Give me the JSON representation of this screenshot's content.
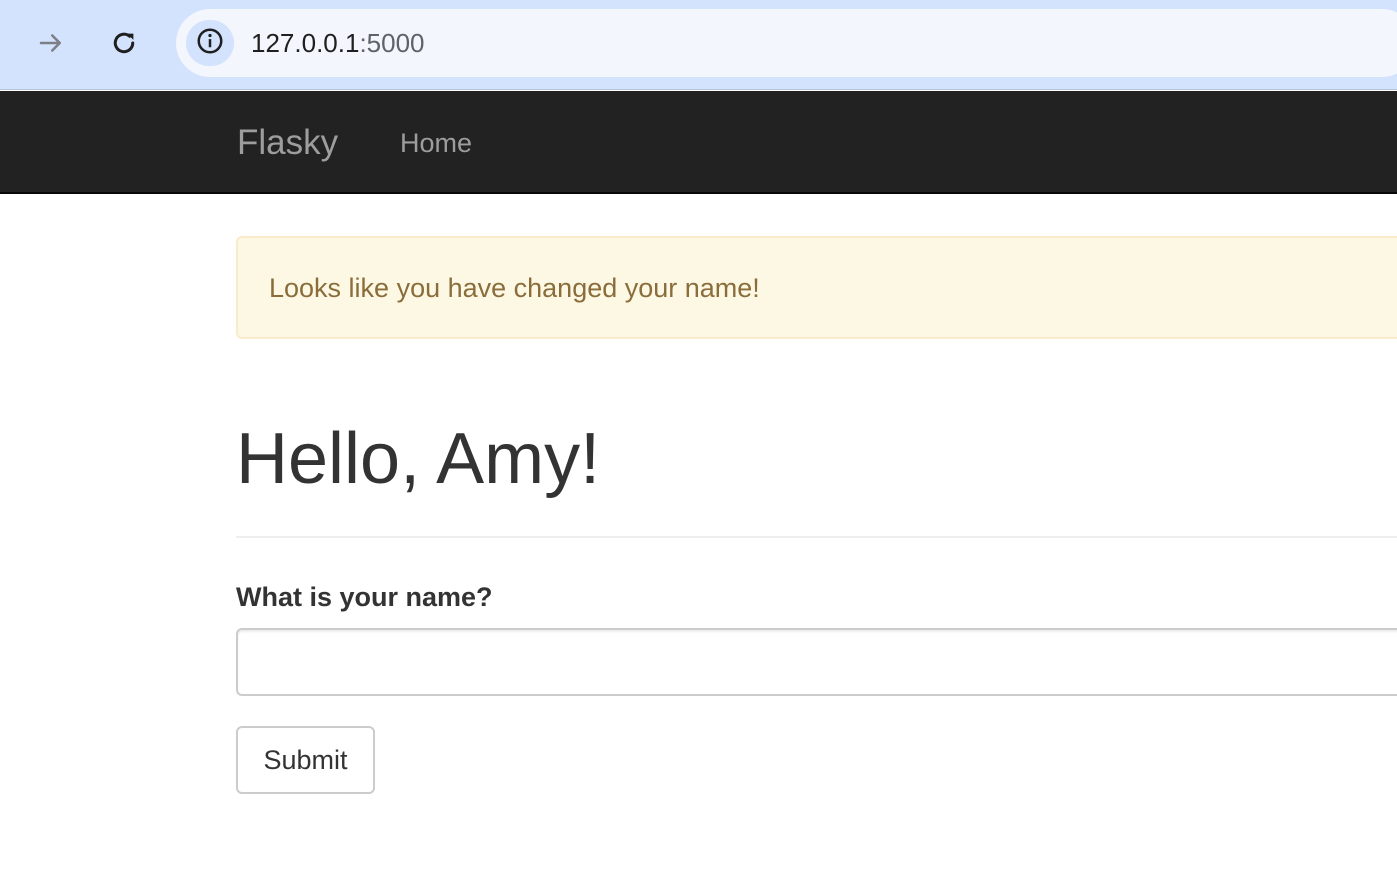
{
  "browser": {
    "url_host": "127.0.0.1",
    "url_port": ":5000",
    "forward_icon": "arrow-right-icon",
    "reload_icon": "reload-icon",
    "site_info_icon": "info-icon"
  },
  "navbar": {
    "brand": "Flasky",
    "links": [
      "Home"
    ]
  },
  "alert": {
    "message": "Looks like you have changed your name!"
  },
  "page": {
    "title": "Hello, Amy!"
  },
  "form": {
    "name_label": "What is your name?",
    "name_value": "",
    "submit_label": "Submit"
  },
  "colors": {
    "chrome_bar": "#d3e3fd",
    "navbar_bg": "#222222",
    "navbar_text": "#9d9d9d",
    "alert_bg": "#fcf8e3",
    "alert_border": "#faebcc",
    "alert_text": "#8a6d3b",
    "body_text": "#333333"
  }
}
